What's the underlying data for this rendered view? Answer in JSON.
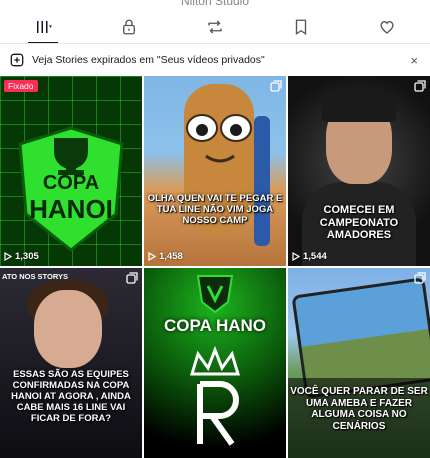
{
  "header": {
    "username": "Nilton Studio"
  },
  "tabs": [
    {
      "name": "videos",
      "icon": "grid-icon",
      "active": true
    },
    {
      "name": "private",
      "icon": "lock-icon",
      "active": false
    },
    {
      "name": "reposts",
      "icon": "repost-icon",
      "active": false
    },
    {
      "name": "favorites",
      "icon": "bookmark-icon",
      "active": false
    },
    {
      "name": "liked",
      "icon": "heart-icon",
      "active": false
    }
  ],
  "banner": {
    "text": "Veja Stories expirados em \"Seus vídeos privados\"",
    "close": "×"
  },
  "videos": [
    {
      "pinned_label": "Fixado",
      "title_line1": "COPA",
      "title_line2": "HANOI",
      "views": "1,305"
    },
    {
      "caption": "OLHA QUEN VAI TE PEGAR E TUA LINE NÃO VIM JOGA NOSSO CAMP",
      "views": "1,458"
    },
    {
      "caption": "COMECEI EM CAMPEONATO AMADORES",
      "views": "1,544"
    },
    {
      "top_text": "ATO NOS STORYS",
      "caption": "ESSAS SÃO AS EQUIPES CONFIRMADAS NA COPA HANOI AT AGORA , AINDA CABE MAIS 16 LINE VAI FICAR DE FORA?"
    },
    {
      "title": "COPA HANO"
    },
    {
      "caption": "VOCÊ QUER PARAR DE SER UMA AMEBA E FAZER ALGUMA COISA NO CENÁRIOS"
    }
  ],
  "colors": {
    "accent": "#fe2c55",
    "text": "#161823",
    "neon_green": "#23d823"
  }
}
